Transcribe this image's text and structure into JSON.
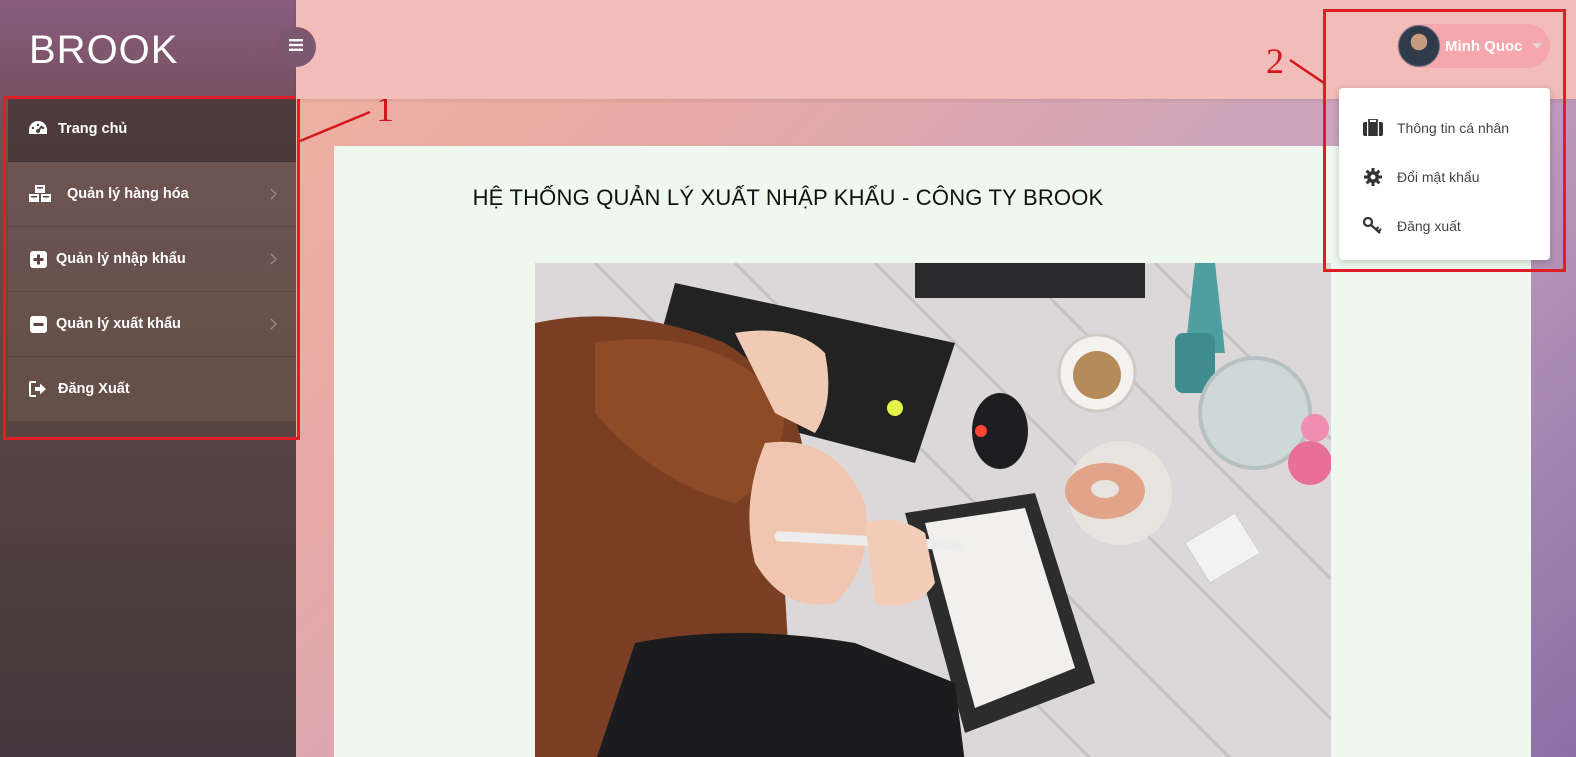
{
  "brand": {
    "name": "BROOK"
  },
  "sidebar": {
    "items": [
      {
        "label": "Trang chủ",
        "icon": "dashboard-icon",
        "active": true,
        "has_submenu": false
      },
      {
        "label": "Quản lý hàng hóa",
        "icon": "cubes-icon",
        "active": false,
        "has_submenu": true
      },
      {
        "label": "Quản lý nhập khẩu",
        "icon": "plus-square-icon",
        "active": false,
        "has_submenu": true
      },
      {
        "label": "Quản lý xuất khẩu",
        "icon": "minus-square-icon",
        "active": false,
        "has_submenu": true
      },
      {
        "label": "Đăng Xuất",
        "icon": "sign-out-icon",
        "active": false,
        "has_submenu": false
      }
    ]
  },
  "user": {
    "name": "Minh Quoc",
    "menu": [
      {
        "label": "Thông tin cá nhân",
        "icon": "briefcase-icon"
      },
      {
        "label": "Đổi mật khẩu",
        "icon": "gear-icon"
      },
      {
        "label": "Đăng xuất",
        "icon": "key-icon"
      }
    ]
  },
  "main": {
    "title": "HỆ THỐNG QUẢN LÝ XUẤT NHẬP KHẨU - CÔNG TY BROOK"
  },
  "annotations": {
    "one": "1",
    "two": "2"
  },
  "colors": {
    "annotation": "#e11e26",
    "topbar": "#f2bcb8",
    "card": "#eef8ef",
    "user_pill": "#f5a7ad"
  }
}
